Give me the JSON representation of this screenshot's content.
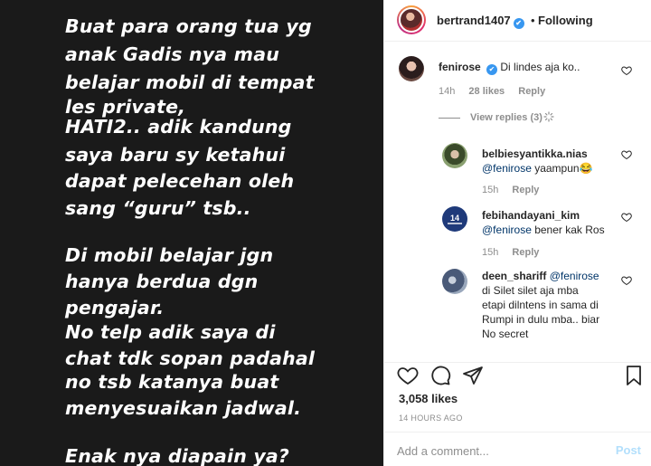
{
  "story": {
    "lines": [
      "Buat para orang tua yg",
      "anak Gadis nya mau",
      "belajar mobil di tempat",
      "les private,",
      "HATI2.. adik kandung",
      "saya baru sy ketahui",
      "dapat pelecehan oleh",
      "sang “guru” tsb..",
      "",
      "Di mobil belajar jgn",
      "hanya berdua dgn",
      "pengajar.",
      "No telp adik saya di",
      "chat tdk sopan padahal",
      "no tsb katanya buat",
      "menyesuaikan jadwal.",
      "",
      "Enak nya diapain ya?"
    ]
  },
  "header": {
    "username": "bertrand1407",
    "verified": "✔",
    "separator": "•",
    "follow_status": "Following"
  },
  "comments": [
    {
      "username": "fenirose",
      "verified": "✔",
      "text": "Di lindes aja ko..",
      "time": "14h",
      "likes": "28 likes",
      "reply": "Reply"
    }
  ],
  "view_replies": "View replies (3)",
  "replies": [
    {
      "username": "belbiesyantikka.nias",
      "mention": "@fenirose",
      "text": " yaampun😂",
      "time": "15h",
      "reply": "Reply"
    },
    {
      "username": "febihandayani_kim",
      "mention": "@fenirose",
      "text": " bener kak Ros",
      "time": "15h",
      "reply": "Reply"
    },
    {
      "username": "deen_shariff",
      "mention": "@fenirose",
      "text_lines": [
        "di Silet silet aja mba",
        "etapi dilntens in sama di",
        "Rumpi in dulu mba.. biar",
        "No secret"
      ]
    }
  ],
  "likes_count": "3,058 likes",
  "time_ago": "14 HOURS AGO",
  "add_comment": {
    "placeholder": "Add a comment...",
    "post_label": "Post"
  },
  "colors": {
    "story_bg": "#1a1a1a",
    "verified_blue": "#3897f0",
    "post_disabled": "#b2dffc",
    "meta_gray": "#8e8e8e"
  }
}
